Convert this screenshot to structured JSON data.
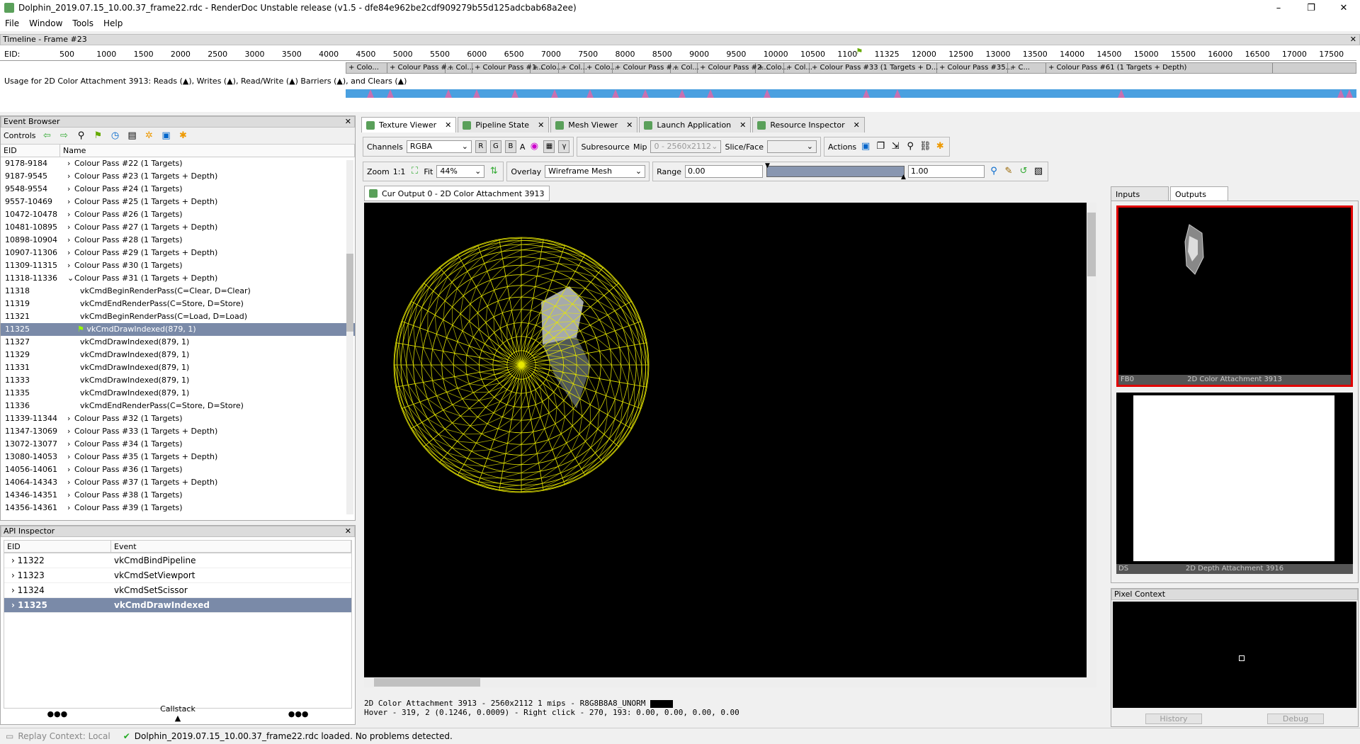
{
  "window": {
    "title": "Dolphin_2019.07.15_10.00.37_frame22.rdc - RenderDoc Unstable release (v1.5 - dfe84e962be2cdf909279b55d125adcbab68a2ee)",
    "minimize": "–",
    "maximize": "❐",
    "close": "✕"
  },
  "menu": [
    "File",
    "Window",
    "Tools",
    "Help"
  ],
  "timeline": {
    "title": "Timeline - Frame #23",
    "eid_label": "EID:",
    "ticks": [
      "500",
      "1000",
      "1500",
      "2000",
      "2500",
      "3000",
      "3500",
      "4000",
      "4500",
      "5000",
      "5500",
      "6000",
      "6500",
      "7000",
      "7500",
      "8000",
      "8500",
      "9000",
      "9500",
      "10000",
      "10500",
      "1100",
      "11325",
      "12000",
      "12500",
      "13000",
      "13500",
      "14000",
      "14500",
      "15000",
      "15500",
      "16000",
      "16500",
      "17000",
      "17500"
    ],
    "passes": [
      "+ Colo...",
      "+ Colour Pass #...",
      "+ Col...",
      "+ Colour Pass #1...",
      "+ Colo...",
      "+ Col...",
      "+ Colo...",
      "+ Colour Pass #...",
      "+ Col...",
      "+ Colour Pass #2...",
      "+ Colo...",
      "+ Col...",
      "+ Colour Pass #33 (1 Targets + D...",
      "+ Colour Pass #35...",
      "+ C...",
      "+ Colour Pass #61 (1 Targets + Depth)"
    ],
    "usage": "Usage for 2D Color Attachment 3913: Reads (▲), Writes (▲), Read/Write (▲) Barriers (▲), and Clears (▲)"
  },
  "event_browser": {
    "title": "Event Browser",
    "controls_label": "Controls",
    "col_eid": "EID",
    "col_name": "Name",
    "rows": [
      {
        "eid": "9178-9184",
        "name": "Colour Pass #22 (1 Targets)",
        "exp": "›",
        "lvl": 0
      },
      {
        "eid": "9187-9545",
        "name": "Colour Pass #23 (1 Targets + Depth)",
        "exp": "›",
        "lvl": 0
      },
      {
        "eid": "9548-9554",
        "name": "Colour Pass #24 (1 Targets)",
        "exp": "›",
        "lvl": 0
      },
      {
        "eid": "9557-10469",
        "name": "Colour Pass #25 (1 Targets + Depth)",
        "exp": "›",
        "lvl": 0
      },
      {
        "eid": "10472-10478",
        "name": "Colour Pass #26 (1 Targets)",
        "exp": "›",
        "lvl": 0
      },
      {
        "eid": "10481-10895",
        "name": "Colour Pass #27 (1 Targets + Depth)",
        "exp": "›",
        "lvl": 0
      },
      {
        "eid": "10898-10904",
        "name": "Colour Pass #28 (1 Targets)",
        "exp": "›",
        "lvl": 0
      },
      {
        "eid": "10907-11306",
        "name": "Colour Pass #29 (1 Targets + Depth)",
        "exp": "›",
        "lvl": 0
      },
      {
        "eid": "11309-11315",
        "name": "Colour Pass #30 (1 Targets)",
        "exp": "›",
        "lvl": 0
      },
      {
        "eid": "11318-11336",
        "name": "Colour Pass #31 (1 Targets + Depth)",
        "exp": "⌄",
        "lvl": 0
      },
      {
        "eid": "11318",
        "name": "vkCmdBeginRenderPass(C=Clear, D=Clear)",
        "exp": "",
        "lvl": 1
      },
      {
        "eid": "11319",
        "name": "vkCmdEndRenderPass(C=Store, D=Store)",
        "exp": "",
        "lvl": 1
      },
      {
        "eid": "11321",
        "name": "vkCmdBeginRenderPass(C=Load, D=Load)",
        "exp": "",
        "lvl": 1
      },
      {
        "eid": "11325",
        "name": "vkCmdDrawIndexed(879, 1)",
        "exp": "",
        "lvl": 2,
        "sel": true
      },
      {
        "eid": "11327",
        "name": "vkCmdDrawIndexed(879, 1)",
        "exp": "",
        "lvl": 1
      },
      {
        "eid": "11329",
        "name": "vkCmdDrawIndexed(879, 1)",
        "exp": "",
        "lvl": 1
      },
      {
        "eid": "11331",
        "name": "vkCmdDrawIndexed(879, 1)",
        "exp": "",
        "lvl": 1
      },
      {
        "eid": "11333",
        "name": "vkCmdDrawIndexed(879, 1)",
        "exp": "",
        "lvl": 1
      },
      {
        "eid": "11335",
        "name": "vkCmdDrawIndexed(879, 1)",
        "exp": "",
        "lvl": 1
      },
      {
        "eid": "11336",
        "name": "vkCmdEndRenderPass(C=Store, D=Store)",
        "exp": "",
        "lvl": 1
      },
      {
        "eid": "11339-11344",
        "name": "Colour Pass #32 (1 Targets)",
        "exp": "›",
        "lvl": 0
      },
      {
        "eid": "11347-13069",
        "name": "Colour Pass #33 (1 Targets + Depth)",
        "exp": "›",
        "lvl": 0
      },
      {
        "eid": "13072-13077",
        "name": "Colour Pass #34 (1 Targets)",
        "exp": "›",
        "lvl": 0
      },
      {
        "eid": "13080-14053",
        "name": "Colour Pass #35 (1 Targets + Depth)",
        "exp": "›",
        "lvl": 0
      },
      {
        "eid": "14056-14061",
        "name": "Colour Pass #36 (1 Targets)",
        "exp": "›",
        "lvl": 0
      },
      {
        "eid": "14064-14343",
        "name": "Colour Pass #37 (1 Targets + Depth)",
        "exp": "›",
        "lvl": 0
      },
      {
        "eid": "14346-14351",
        "name": "Colour Pass #38 (1 Targets)",
        "exp": "›",
        "lvl": 0
      },
      {
        "eid": "14356-14361",
        "name": "Colour Pass #39 (1 Targets)",
        "exp": "›",
        "lvl": 0
      }
    ]
  },
  "api_inspector": {
    "title": "API Inspector",
    "col_eid": "EID",
    "col_event": "Event",
    "rows": [
      {
        "eid": "11322",
        "event": "vkCmdBindPipeline"
      },
      {
        "eid": "11323",
        "event": "vkCmdSetViewport"
      },
      {
        "eid": "11324",
        "event": "vkCmdSetScissor"
      },
      {
        "eid": "11325",
        "event": "vkCmdDrawIndexed",
        "sel": true
      }
    ],
    "dots": "●●●",
    "callstack": "Callstack"
  },
  "tabs": [
    {
      "label": "Texture Viewer",
      "active": true
    },
    {
      "label": "Pipeline State"
    },
    {
      "label": "Mesh Viewer"
    },
    {
      "label": "Launch Application"
    },
    {
      "label": "Resource Inspector"
    }
  ],
  "texture_viewer": {
    "channels_label": "Channels",
    "channels_value": "RGBA",
    "r": "R",
    "g": "G",
    "b": "B",
    "a": "A",
    "gamma": "γ",
    "subresource_label": "Subresource",
    "mip_label": "Mip",
    "mip_value": "0 - 2560x2112",
    "slice_label": "Slice/Face",
    "actions_label": "Actions",
    "zoom_label": "Zoom",
    "zoom_one": "1:1",
    "fit_label": "Fit",
    "zoom_value": "44%",
    "overlay_label": "Overlay",
    "overlay_value": "Wireframe Mesh",
    "range_label": "Range",
    "range_min": "0.00",
    "range_max": "1.00",
    "cur_output_tab": "Cur Output 0 - 2D Color Attachment 3913",
    "status_line1": "2D Color Attachment 3913 - 2560x2112 1 mips - R8G8B8A8_UNORM",
    "status_line2": "Hover -   319,     2 (0.1246, 0.0009) - Right click -   270,   193: 0.00, 0.00, 0.00, 0.00",
    "wire_color": "#e8e800"
  },
  "right_panel": {
    "tab_inputs": "Inputs",
    "tab_outputs": "Outputs",
    "thumb1_slot": "FB0",
    "thumb1_name": "2D Color Attachment 3913",
    "thumb2_slot": "DS",
    "thumb2_name": "2D Depth Attachment 3916",
    "pixel_context_title": "Pixel Context",
    "history_btn": "History",
    "debug_btn": "Debug"
  },
  "statusbar": {
    "replay": "Replay Context: Local",
    "message": "Dolphin_2019.07.15_10.00.37_frame22.rdc loaded. No problems detected."
  }
}
